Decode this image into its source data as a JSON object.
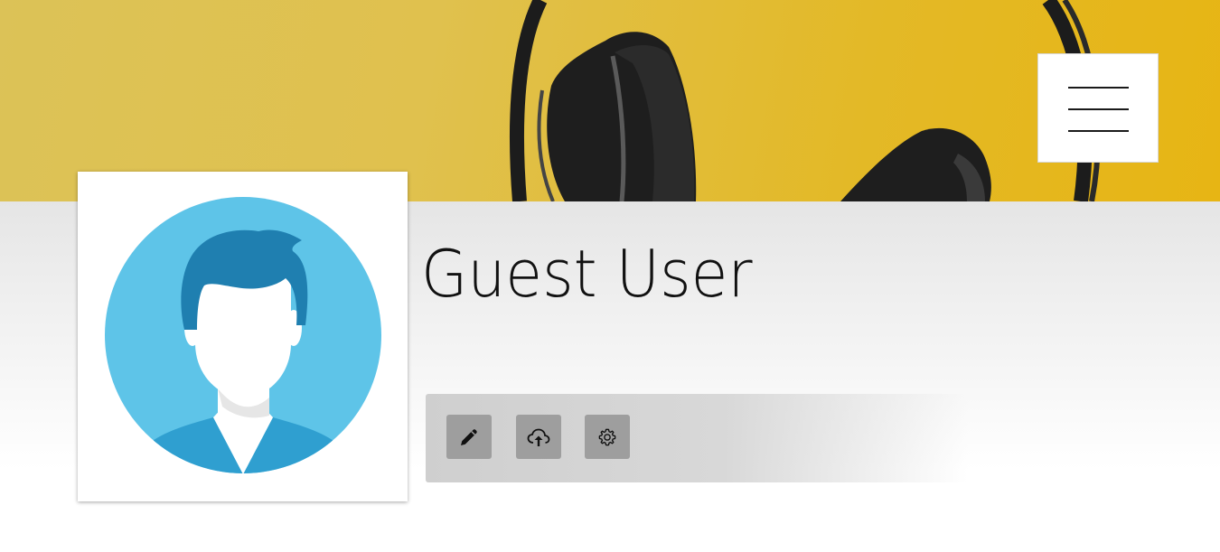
{
  "banner": {
    "image": "headphones-on-yellow-background"
  },
  "header": {
    "menu_icon": "hamburger-menu-icon"
  },
  "profile": {
    "avatar_icon": "default-user-avatar",
    "name": "Guest User"
  },
  "toolbar": {
    "buttons": [
      {
        "icon": "pencil-edit-icon"
      },
      {
        "icon": "cloud-upload-icon"
      },
      {
        "icon": "gear-settings-icon"
      }
    ]
  },
  "colors": {
    "banner_yellow": "#e3b927",
    "avatar_circle": "#5ec4e8",
    "avatar_hair": "#1f7fb0",
    "tool_button": "#9e9e9e"
  }
}
